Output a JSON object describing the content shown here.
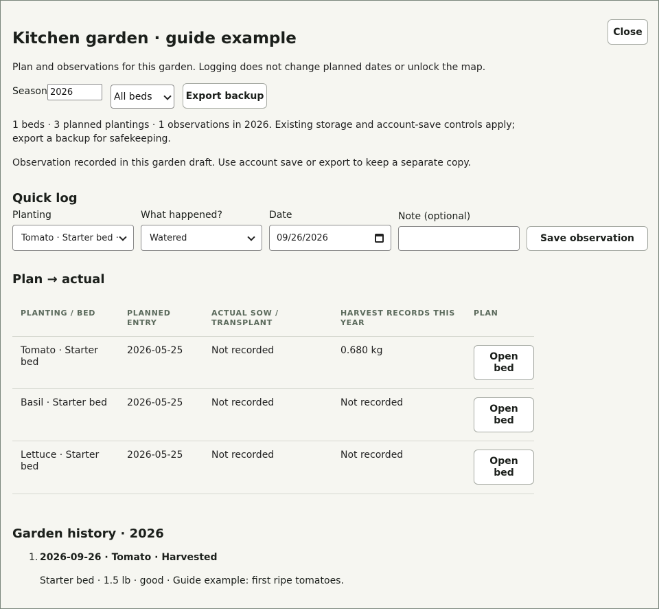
{
  "dialog": {
    "close_label": "Close",
    "title": "Kitchen garden · guide example",
    "intro": "Plan and observations for this garden. Logging does not change planned dates or unlock the map."
  },
  "controls": {
    "season_label": "Season",
    "season_value": "2026",
    "beds_selected": "All beds",
    "export_label": "Export backup"
  },
  "summary": "1 beds · 3 planned plantings · 1 observations in 2026. Existing storage and account-save controls apply; export a backup for safekeeping.",
  "status_message": "Observation recorded in this garden draft. Use account save or export to keep a separate copy.",
  "quick_log": {
    "heading": "Quick log",
    "planting_label": "Planting",
    "planting_value": "Tomato · Starter bed ·",
    "what_label": "What happened?",
    "what_value": "Watered",
    "date_label": "Date",
    "date_value": "09/26/2026",
    "note_label": "Note (optional)",
    "note_value": "",
    "save_label": "Save observation"
  },
  "plan_actual": {
    "heading": "Plan → actual",
    "columns": [
      "PLANTING / BED",
      "PLANNED ENTRY",
      "ACTUAL SOW / TRANSPLANT",
      "HARVEST RECORDS THIS YEAR",
      "PLAN"
    ],
    "rows": [
      {
        "planting": "Tomato · Starter bed",
        "planned": "2026-05-25",
        "actual": "Not recorded",
        "harvest": "0.680 kg",
        "action": "Open bed"
      },
      {
        "planting": "Basil · Starter bed",
        "planned": "2026-05-25",
        "actual": "Not recorded",
        "harvest": "Not recorded",
        "action": "Open bed"
      },
      {
        "planting": "Lettuce · Starter bed",
        "planned": "2026-05-25",
        "actual": "Not recorded",
        "harvest": "Not recorded",
        "action": "Open bed"
      }
    ]
  },
  "history": {
    "heading": "Garden history · 2026",
    "items": [
      {
        "number": "1.",
        "title": "2026-09-26 · Tomato · Harvested",
        "detail": "Starter bed · 1.5 lb · good · Guide example: first ripe tomatoes."
      }
    ]
  }
}
